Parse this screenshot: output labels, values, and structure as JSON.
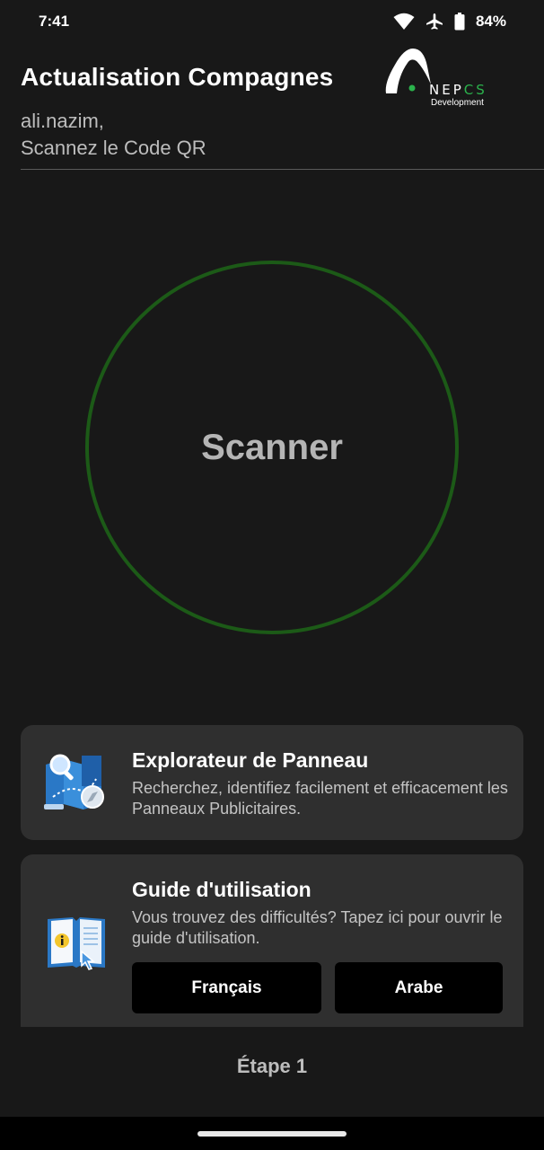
{
  "status_bar": {
    "time": "7:41",
    "battery": "84%",
    "icons": [
      "wifi-icon",
      "airplane-icon",
      "battery-icon"
    ]
  },
  "header": {
    "title": "Actualisation Compagnes",
    "user": "ali.nazim,",
    "instruction": "Scannez le Code QR",
    "logo": {
      "text_main": "NEP",
      "text_accent": "CS",
      "subtitle": "Development"
    }
  },
  "scanner": {
    "label": "Scanner",
    "ring_color": "#1c5a17"
  },
  "explorer_card": {
    "title": "Explorateur de Panneau",
    "description": "Recherchez, identifiez facilement et efficacement les Panneaux Publicitaires.",
    "icon": "map-search-icon"
  },
  "guide_card": {
    "title": "Guide d'utilisation",
    "description": "Vous trouvez des difficultés? Tapez ici pour ouvrir le guide d'utilisation.",
    "icon": "guide-book-icon",
    "buttons": {
      "french": "Français",
      "arabic": "Arabe"
    }
  },
  "footer": {
    "step": "Étape 1"
  },
  "colors": {
    "background": "#181818",
    "card": "#2f2f2f",
    "accent_green": "#2bb24c"
  }
}
